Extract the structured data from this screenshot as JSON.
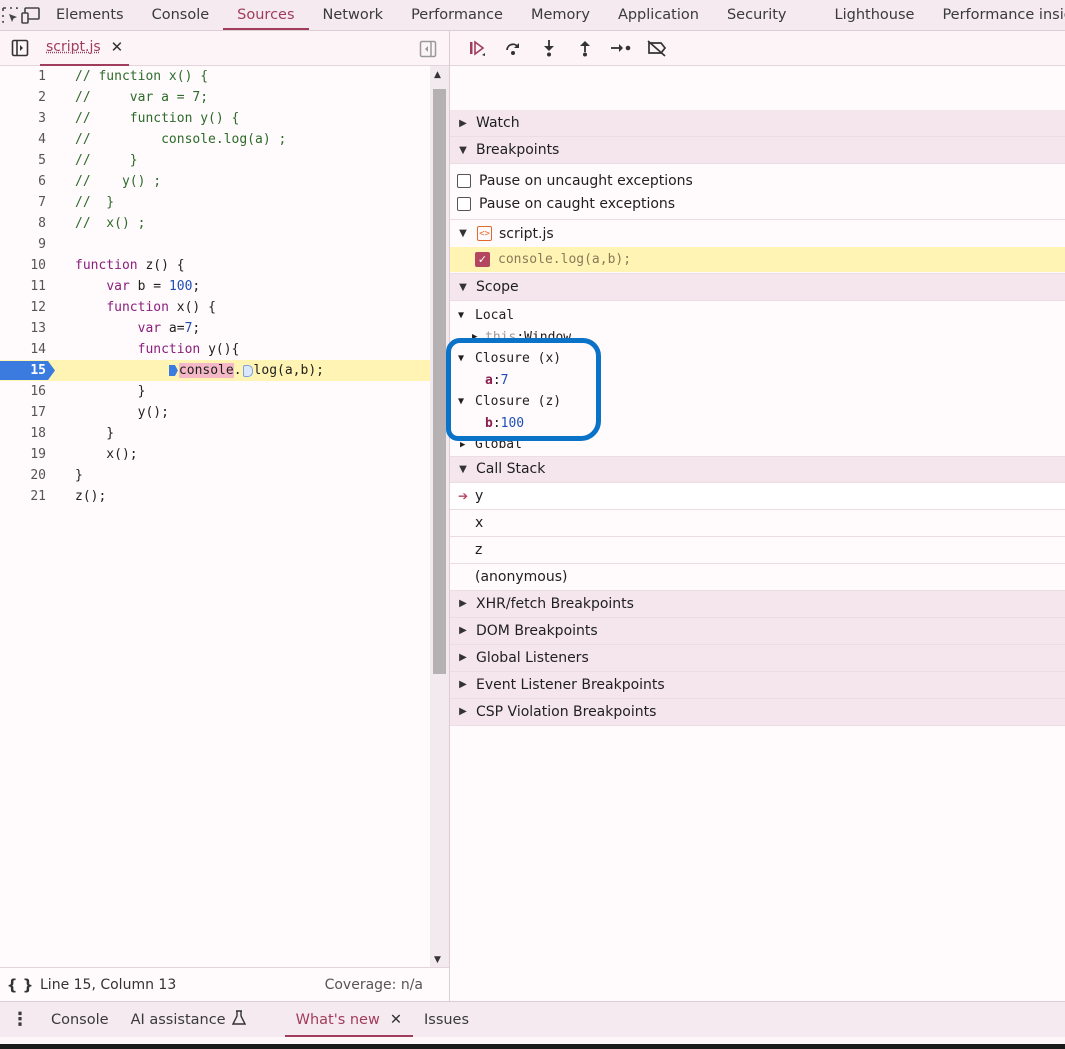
{
  "toolbar": {
    "tabs": [
      "Elements",
      "Console",
      "Sources",
      "Network",
      "Performance",
      "Memory",
      "Application",
      "Security",
      "Lighthouse",
      "Performance insights"
    ],
    "active_tab": "Sources"
  },
  "editor": {
    "file_tab": "script.js",
    "lines": [
      {
        "n": "1",
        "text": "// function x() {"
      },
      {
        "n": "2",
        "text": "//     var a = 7;"
      },
      {
        "n": "3",
        "text": "//     function y() {"
      },
      {
        "n": "4",
        "text": "//         console.log(a) ;"
      },
      {
        "n": "5",
        "text": "//     }"
      },
      {
        "n": "6",
        "text": "//    y() ;"
      },
      {
        "n": "7",
        "text": "//  }"
      },
      {
        "n": "8",
        "text": "//  x() ;"
      },
      {
        "n": "9",
        "text": ""
      },
      {
        "n": "10",
        "text": "function z() {"
      },
      {
        "n": "11",
        "text": "    var b = 100;"
      },
      {
        "n": "12",
        "text": "    function x() {"
      },
      {
        "n": "13",
        "text": "        var a=7;"
      },
      {
        "n": "14",
        "text": "        function y(){"
      },
      {
        "n": "15",
        "text": "            console.log(a,b);"
      },
      {
        "n": "16",
        "text": "        }"
      },
      {
        "n": "17",
        "text": "        y();"
      },
      {
        "n": "18",
        "text": "    }"
      },
      {
        "n": "19",
        "text": "    x();"
      },
      {
        "n": "20",
        "text": "}"
      },
      {
        "n": "21",
        "text": "z();"
      }
    ],
    "current_line": "15",
    "status_position": "Line 15, Column 13",
    "coverage": "Coverage: n/a"
  },
  "debugger": {
    "watch_label": "Watch",
    "breakpoints_label": "Breakpoints",
    "pause_uncaught": "Pause on uncaught exceptions",
    "pause_caught": "Pause on caught exceptions",
    "bp_file": "script.js",
    "bp_code": "console.log(a,b);",
    "scope_label": "Scope",
    "scope": {
      "local": "Local",
      "this_key": "this",
      "this_val": "Window",
      "closure_x": "Closure (x)",
      "a_key": "a",
      "a_val": "7",
      "closure_z": "Closure (z)",
      "b_key": "b",
      "b_val": "100",
      "global": "Global"
    },
    "callstack_label": "Call Stack",
    "callstack": [
      "y",
      "x",
      "z",
      "(anonymous)"
    ],
    "collapsed_sections": [
      "XHR/fetch Breakpoints",
      "DOM Breakpoints",
      "Global Listeners",
      "Event Listener Breakpoints",
      "CSP Violation Breakpoints"
    ]
  },
  "drawer": {
    "tabs": [
      "Console",
      "AI assistance",
      "What's new",
      "Issues"
    ],
    "active": "What's new"
  },
  "colors": {
    "accent": "#a03d5c",
    "breakpoint_blue": "#3b7be0",
    "annotation_circle": "#0a72c7",
    "current_line_bg": "#fff4b3"
  }
}
